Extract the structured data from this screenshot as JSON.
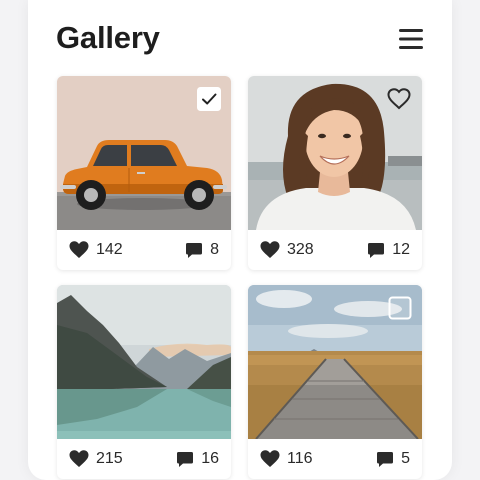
{
  "header": {
    "title": "Gallery",
    "menu_icon": "hamburger-menu-icon"
  },
  "colors": {
    "text": "#1e1e1e",
    "icon": "#2b2b2b",
    "card_background": "#ffffff",
    "page_background": "#f3f3f5"
  },
  "photos": [
    {
      "subject": "orange vintage car",
      "likes": "142",
      "comments": "8",
      "overlay": "checkbox",
      "overlay_checked": true
    },
    {
      "subject": "smiling woman portrait",
      "likes": "328",
      "comments": "12",
      "overlay": "heart",
      "overlay_checked": false
    },
    {
      "subject": "mountain lake",
      "likes": "215",
      "comments": "16",
      "overlay": "none",
      "overlay_checked": false
    },
    {
      "subject": "wooden boardwalk through grassland",
      "likes": "116",
      "comments": "5",
      "overlay": "checkbox",
      "overlay_checked": false
    }
  ]
}
